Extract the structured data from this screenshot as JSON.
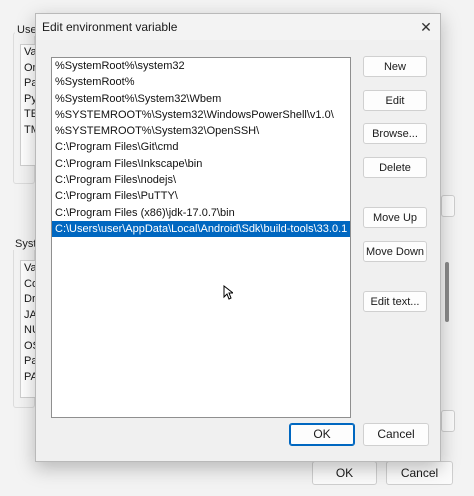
{
  "background": {
    "user_group_label": "User",
    "user_vars_fragment": [
      "Va",
      "On",
      "Pa",
      "Py",
      "TE",
      "TM"
    ],
    "system_group_label": "Syste",
    "system_vars_fragment": [
      "Va",
      "Co",
      "Dr",
      "JA",
      "NU",
      "OS",
      "Pa",
      "PA"
    ],
    "ok_label": "OK",
    "cancel_label": "Cancel"
  },
  "dialog": {
    "title": "Edit environment variable",
    "entries": [
      "%SystemRoot%\\system32",
      "%SystemRoot%",
      "%SystemRoot%\\System32\\Wbem",
      "%SYSTEMROOT%\\System32\\WindowsPowerShell\\v1.0\\",
      "%SYSTEMROOT%\\System32\\OpenSSH\\",
      "C:\\Program Files\\Git\\cmd",
      "C:\\Program Files\\Inkscape\\bin",
      "C:\\Program Files\\nodejs\\",
      "C:\\Program Files\\PuTTY\\",
      "C:\\Program Files (x86)\\jdk-17.0.7\\bin",
      "C:\\Users\\user\\AppData\\Local\\Android\\Sdk\\build-tools\\33.0.1"
    ],
    "selected_index": 10,
    "buttons": {
      "new": "New",
      "edit": "Edit",
      "browse": "Browse...",
      "delete": "Delete",
      "move_up": "Move Up",
      "move_down": "Move Down",
      "edit_text": "Edit text...",
      "ok": "OK",
      "cancel": "Cancel"
    },
    "selection_color": "#0067c0"
  }
}
